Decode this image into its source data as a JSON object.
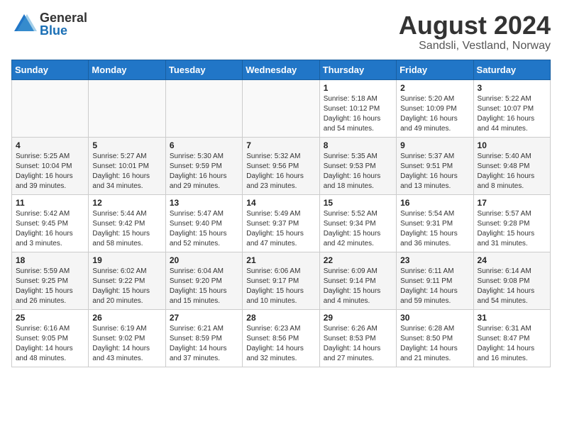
{
  "header": {
    "logo_general": "General",
    "logo_blue": "Blue",
    "month_year": "August 2024",
    "location": "Sandsli, Vestland, Norway"
  },
  "days_of_week": [
    "Sunday",
    "Monday",
    "Tuesday",
    "Wednesday",
    "Thursday",
    "Friday",
    "Saturday"
  ],
  "weeks": [
    [
      {
        "day": "",
        "info": ""
      },
      {
        "day": "",
        "info": ""
      },
      {
        "day": "",
        "info": ""
      },
      {
        "day": "",
        "info": ""
      },
      {
        "day": "1",
        "info": "Sunrise: 5:18 AM\nSunset: 10:12 PM\nDaylight: 16 hours\nand 54 minutes."
      },
      {
        "day": "2",
        "info": "Sunrise: 5:20 AM\nSunset: 10:09 PM\nDaylight: 16 hours\nand 49 minutes."
      },
      {
        "day": "3",
        "info": "Sunrise: 5:22 AM\nSunset: 10:07 PM\nDaylight: 16 hours\nand 44 minutes."
      }
    ],
    [
      {
        "day": "4",
        "info": "Sunrise: 5:25 AM\nSunset: 10:04 PM\nDaylight: 16 hours\nand 39 minutes."
      },
      {
        "day": "5",
        "info": "Sunrise: 5:27 AM\nSunset: 10:01 PM\nDaylight: 16 hours\nand 34 minutes."
      },
      {
        "day": "6",
        "info": "Sunrise: 5:30 AM\nSunset: 9:59 PM\nDaylight: 16 hours\nand 29 minutes."
      },
      {
        "day": "7",
        "info": "Sunrise: 5:32 AM\nSunset: 9:56 PM\nDaylight: 16 hours\nand 23 minutes."
      },
      {
        "day": "8",
        "info": "Sunrise: 5:35 AM\nSunset: 9:53 PM\nDaylight: 16 hours\nand 18 minutes."
      },
      {
        "day": "9",
        "info": "Sunrise: 5:37 AM\nSunset: 9:51 PM\nDaylight: 16 hours\nand 13 minutes."
      },
      {
        "day": "10",
        "info": "Sunrise: 5:40 AM\nSunset: 9:48 PM\nDaylight: 16 hours\nand 8 minutes."
      }
    ],
    [
      {
        "day": "11",
        "info": "Sunrise: 5:42 AM\nSunset: 9:45 PM\nDaylight: 16 hours\nand 3 minutes."
      },
      {
        "day": "12",
        "info": "Sunrise: 5:44 AM\nSunset: 9:42 PM\nDaylight: 15 hours\nand 58 minutes."
      },
      {
        "day": "13",
        "info": "Sunrise: 5:47 AM\nSunset: 9:40 PM\nDaylight: 15 hours\nand 52 minutes."
      },
      {
        "day": "14",
        "info": "Sunrise: 5:49 AM\nSunset: 9:37 PM\nDaylight: 15 hours\nand 47 minutes."
      },
      {
        "day": "15",
        "info": "Sunrise: 5:52 AM\nSunset: 9:34 PM\nDaylight: 15 hours\nand 42 minutes."
      },
      {
        "day": "16",
        "info": "Sunrise: 5:54 AM\nSunset: 9:31 PM\nDaylight: 15 hours\nand 36 minutes."
      },
      {
        "day": "17",
        "info": "Sunrise: 5:57 AM\nSunset: 9:28 PM\nDaylight: 15 hours\nand 31 minutes."
      }
    ],
    [
      {
        "day": "18",
        "info": "Sunrise: 5:59 AM\nSunset: 9:25 PM\nDaylight: 15 hours\nand 26 minutes."
      },
      {
        "day": "19",
        "info": "Sunrise: 6:02 AM\nSunset: 9:22 PM\nDaylight: 15 hours\nand 20 minutes."
      },
      {
        "day": "20",
        "info": "Sunrise: 6:04 AM\nSunset: 9:20 PM\nDaylight: 15 hours\nand 15 minutes."
      },
      {
        "day": "21",
        "info": "Sunrise: 6:06 AM\nSunset: 9:17 PM\nDaylight: 15 hours\nand 10 minutes."
      },
      {
        "day": "22",
        "info": "Sunrise: 6:09 AM\nSunset: 9:14 PM\nDaylight: 15 hours\nand 4 minutes."
      },
      {
        "day": "23",
        "info": "Sunrise: 6:11 AM\nSunset: 9:11 PM\nDaylight: 14 hours\nand 59 minutes."
      },
      {
        "day": "24",
        "info": "Sunrise: 6:14 AM\nSunset: 9:08 PM\nDaylight: 14 hours\nand 54 minutes."
      }
    ],
    [
      {
        "day": "25",
        "info": "Sunrise: 6:16 AM\nSunset: 9:05 PM\nDaylight: 14 hours\nand 48 minutes."
      },
      {
        "day": "26",
        "info": "Sunrise: 6:19 AM\nSunset: 9:02 PM\nDaylight: 14 hours\nand 43 minutes."
      },
      {
        "day": "27",
        "info": "Sunrise: 6:21 AM\nSunset: 8:59 PM\nDaylight: 14 hours\nand 37 minutes."
      },
      {
        "day": "28",
        "info": "Sunrise: 6:23 AM\nSunset: 8:56 PM\nDaylight: 14 hours\nand 32 minutes."
      },
      {
        "day": "29",
        "info": "Sunrise: 6:26 AM\nSunset: 8:53 PM\nDaylight: 14 hours\nand 27 minutes."
      },
      {
        "day": "30",
        "info": "Sunrise: 6:28 AM\nSunset: 8:50 PM\nDaylight: 14 hours\nand 21 minutes."
      },
      {
        "day": "31",
        "info": "Sunrise: 6:31 AM\nSunset: 8:47 PM\nDaylight: 14 hours\nand 16 minutes."
      }
    ]
  ]
}
